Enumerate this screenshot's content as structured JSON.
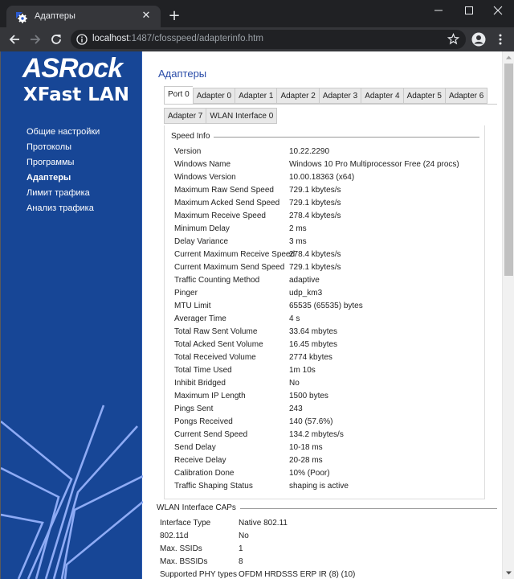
{
  "browser": {
    "tab_title": "Адаптеры",
    "tab_close": "✕",
    "new_tab": "+",
    "window_controls": {
      "minimize": "—",
      "maximize": "☐",
      "close": "✕"
    },
    "url_host": "localhost",
    "url_rest": ":1487/cfosspeed/adapterinfo.htm",
    "icons": [
      "favicon-gear",
      "back-arrow",
      "forward-arrow",
      "reload",
      "info",
      "star",
      "profile",
      "menu-kebab"
    ]
  },
  "sidebar": {
    "brand": "ASRock",
    "product": "XFast LAN",
    "items": [
      {
        "label": "Общие настройки",
        "active": false
      },
      {
        "label": "Протоколы",
        "active": false
      },
      {
        "label": "Программы",
        "active": false
      },
      {
        "label": "Адаптеры",
        "active": true
      },
      {
        "label": "Лимит трафика",
        "active": false
      },
      {
        "label": "Анализ трафика",
        "active": false
      }
    ]
  },
  "main": {
    "title": "Адаптеры",
    "tabs_row1": [
      "Port 0",
      "Adapter 0",
      "Adapter 1",
      "Adapter 2",
      "Adapter 3",
      "Adapter 4",
      "Adapter 5",
      "Adapter 6"
    ],
    "tabs_row2": [
      "Adapter 7",
      "WLAN Interface 0"
    ],
    "active_tab": "Port 0",
    "speed_info": {
      "legend": "Speed Info",
      "rows": [
        {
          "key": "Version",
          "value": "10.22.2290"
        },
        {
          "key": "Windows Name",
          "value": "Windows 10 Pro Multiprocessor Free (24 procs)"
        },
        {
          "key": "Windows Version",
          "value": "10.00.18363 (x64)"
        },
        {
          "key": "Maximum Raw Send Speed",
          "value": "729.1 kbytes/s"
        },
        {
          "key": "Maximum Acked Send Speed",
          "value": "729.1 kbytes/s"
        },
        {
          "key": "Maximum Receive Speed",
          "value": "278.4 kbytes/s"
        },
        {
          "key": "Minimum Delay",
          "value": "2 ms"
        },
        {
          "key": "Delay Variance",
          "value": "3 ms"
        },
        {
          "key": "Current Maximum Receive Speed",
          "value": "278.4 kbytes/s"
        },
        {
          "key": "Current Maximum Send Speed",
          "value": "729.1 kbytes/s"
        },
        {
          "key": "Traffic Counting Method",
          "value": "adaptive"
        },
        {
          "key": "Pinger",
          "value": "udp_km3"
        },
        {
          "key": "MTU Limit",
          "value": "65535 (65535) bytes"
        },
        {
          "key": "Averager Time",
          "value": "4 s"
        },
        {
          "key": "Total Raw Sent Volume",
          "value": "33.64 mbytes"
        },
        {
          "key": "Total Acked Sent Volume",
          "value": "16.45 mbytes"
        },
        {
          "key": "Total Received Volume",
          "value": "2774 kbytes"
        },
        {
          "key": "Total Time Used",
          "value": "1m 10s"
        },
        {
          "key": "Inhibit Bridged",
          "value": "No"
        },
        {
          "key": "Maximum IP Length",
          "value": "1500 bytes"
        },
        {
          "key": "Pings Sent",
          "value": "243"
        },
        {
          "key": "Pongs Received",
          "value": "140 (57.6%)"
        },
        {
          "key": "Current Send Speed",
          "value": "134.2 mbytes/s"
        },
        {
          "key": "Send Delay",
          "value": "10-18 ms"
        },
        {
          "key": "Receive Delay",
          "value": "20-28 ms"
        },
        {
          "key": "Calibration Done",
          "value": "10% (Poor)"
        },
        {
          "key": "Traffic Shaping Status",
          "value": "shaping is active"
        }
      ]
    },
    "wlan_caps": {
      "legend": "WLAN Interface CAPs",
      "rows": [
        {
          "key": "Interface Type",
          "value": "Native 802.11"
        },
        {
          "key": "802.11d",
          "value": "No"
        },
        {
          "key": "Max. SSIDs",
          "value": "1"
        },
        {
          "key": "Max. BSSIDs",
          "value": "8"
        },
        {
          "key": "Supported PHY types",
          "value": "OFDM HRDSSS ERP IR (8) (10)"
        }
      ]
    }
  },
  "colors": {
    "sidebar_bg": "#174696",
    "title_blue": "#2a4ca8",
    "deco_lines": "#8eabf5"
  }
}
